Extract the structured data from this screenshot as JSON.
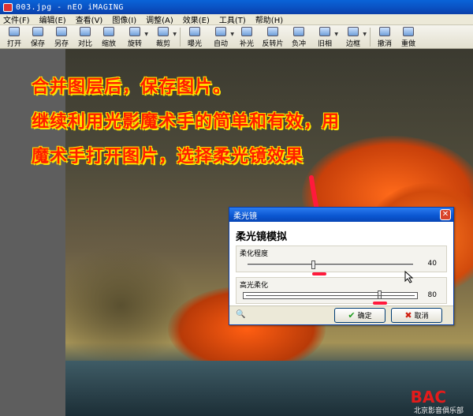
{
  "window": {
    "title": "003.jpg - nEO iMAGING"
  },
  "menu": [
    "文件(F)",
    "编辑(E)",
    "查看(V)",
    "图像(I)",
    "调整(A)",
    "效果(E)",
    "工具(T)",
    "帮助(H)"
  ],
  "toolbar": [
    {
      "label": "打开",
      "icon": "folder-open-icon"
    },
    {
      "label": "保存",
      "icon": "save-icon"
    },
    {
      "label": "另存",
      "icon": "save-as-icon"
    },
    {
      "label": "对比",
      "icon": "compare-icon"
    },
    {
      "label": "缩放",
      "icon": "zoom-icon"
    },
    {
      "label": "旋转",
      "icon": "rotate-icon"
    },
    {
      "label": "裁剪",
      "icon": "crop-icon"
    },
    {
      "label": "曝光",
      "icon": "exposure-icon"
    },
    {
      "label": "自动",
      "icon": "auto-icon"
    },
    {
      "label": "补光",
      "icon": "fill-light-icon"
    },
    {
      "label": "反转片",
      "icon": "slide-film-icon"
    },
    {
      "label": "负冲",
      "icon": "cross-process-icon"
    },
    {
      "label": "旧相",
      "icon": "old-photo-icon"
    },
    {
      "label": "边框",
      "icon": "frame-icon"
    },
    {
      "label": "撤消",
      "icon": "undo-icon"
    },
    {
      "label": "重做",
      "icon": "redo-icon"
    }
  ],
  "notes": {
    "line1": "合并图层后，保存图片。",
    "line2": "继续利用光影魔术手的简单和有效，用",
    "line3": "魔术手打开图片，选择柔光镜效果"
  },
  "dialog": {
    "title": "柔光镜",
    "close": "✕",
    "heading": "柔光镜模拟",
    "soften": {
      "label": "柔化程度",
      "value": "40",
      "level": 0.4
    },
    "highlight": {
      "label": "高光柔化",
      "value": "80",
      "level": 0.8
    },
    "magnifier": "🔍",
    "ok": "确定",
    "ok_glyph": "✔",
    "cancel": "取消",
    "cancel_glyph": "✖"
  },
  "watermark": {
    "logo": "BAC",
    "text": "北京影音俱乐部"
  },
  "colors": {
    "note_text": "#ff1e00",
    "note_outline": "#ffe400",
    "title_bar": "#0a55d0",
    "marker": "#ff1a3c"
  }
}
